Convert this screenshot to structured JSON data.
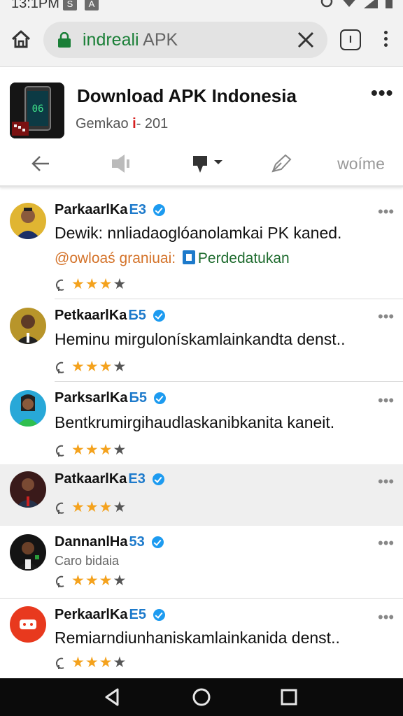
{
  "status_bar": {
    "time": "13:1PM",
    "icon_1": "S",
    "icon_2": "A"
  },
  "browser": {
    "url_host": "indreali",
    "url_rest": " APK",
    "tabs_label": "I"
  },
  "app": {
    "title": "Download APK Indonesia",
    "subtitle_pre": "Gemkao ",
    "subtitle_mark": "i",
    "subtitle_post": "- 201",
    "more_label": "•••",
    "icon_text": "06",
    "toolbar_last_label": "woíme"
  },
  "posts": [
    {
      "name": "ParkaarlKa",
      "tag": "E3",
      "text": "Dewik: nnliadaoglóanolamkai PK kaned.",
      "mention": "@owloaś graniuai:",
      "link_text": "Perdedatukan",
      "stars": 3
    },
    {
      "name": "PetkaarlKa",
      "tag": "Б5",
      "text": "Heminu mirgulonískamlainkandta denst..",
      "stars": 3
    },
    {
      "name": "ParksarlKa",
      "tag": "Б5",
      "text": "Bentkrumirgihaudlaskanibkanita kaneit.",
      "stars": 3
    },
    {
      "name": "PatkaarlKa",
      "tag": "E3",
      "stars": 3
    },
    {
      "name": "DannanlHa",
      "tag": "53",
      "subtext": "Caro bidaia",
      "stars": 3
    },
    {
      "name": "PerkaarlKa",
      "tag": "E5",
      "text": "Remiarndiunhaniskamlainkanida denst..",
      "stars": 3
    }
  ],
  "post_more_label": "•••",
  "star_symbol": "★",
  "colors": {
    "star": "#f4a21d",
    "verified": "#1d9bf0",
    "url_green": "#1a7f37",
    "mention_orange": "#d4732a"
  }
}
